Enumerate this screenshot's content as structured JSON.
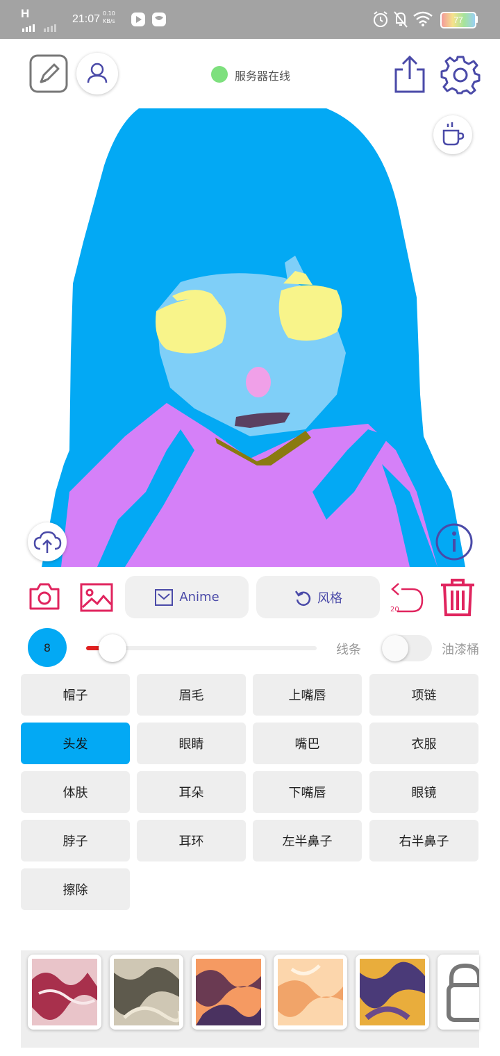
{
  "status_bar": {
    "carrier": "H",
    "time": "21:07",
    "net_speed": "0.10",
    "net_unit": "KB/s",
    "battery": "77"
  },
  "header": {
    "server_status": "服务器在线",
    "status_color": "#7ee07e"
  },
  "tools": {
    "anime_label": "Anime",
    "style_label": "风格",
    "undo_count": "20"
  },
  "brush": {
    "size": "8",
    "line_label": "线条",
    "bucket_label": "油漆桶",
    "slider_fraction": 0.03,
    "bucket_on": false
  },
  "parts": [
    "帽子",
    "眉毛",
    "上嘴唇",
    "项链",
    "头发",
    "眼睛",
    "嘴巴",
    "衣服",
    "体肤",
    "耳朵",
    "下嘴唇",
    "眼镜",
    "脖子",
    "耳环",
    "左半鼻子",
    "右半鼻子",
    "擦除"
  ],
  "selected_part": "头发",
  "colors": {
    "accent": "#03a9f4",
    "icon_red": "#e0245e",
    "icon_indigo": "#4a4aa8",
    "hair": "#03a9f4",
    "skin": "#7fcff8",
    "clothes": "#d580f8",
    "eyes": "#f8f48a",
    "nose": "#f0a0e8",
    "mouth": "#5a4060",
    "necklace": "#8a7a10"
  },
  "icons": {
    "brush_icon": "brush-square",
    "profile_icon": "person",
    "share_icon": "share-up",
    "settings_icon": "gear",
    "coffee_icon": "cup",
    "upload_icon": "cloud-upload",
    "info_icon": "info",
    "camera_icon": "camera",
    "gallery_icon": "image",
    "undo_icon": "undo",
    "trash_icon": "trash",
    "lock_icon": "lock"
  }
}
